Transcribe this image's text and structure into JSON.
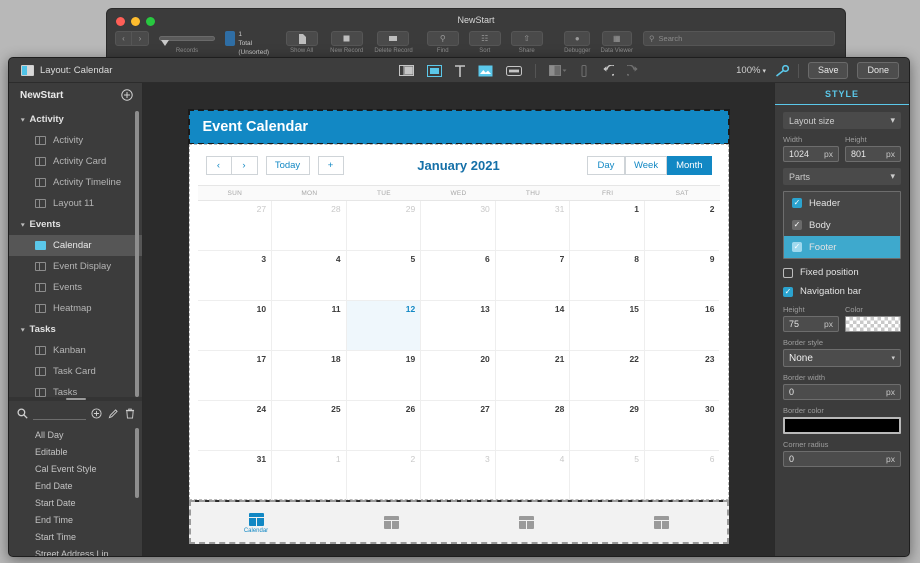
{
  "fm_window": {
    "title": "NewStart",
    "records_label": "Records",
    "record_number": "1",
    "record_total": "Total (Unsorted)",
    "buttons": [
      {
        "label": "Show All",
        "icon": "document-icon"
      },
      {
        "label": "New Record",
        "icon": "new-record-icon"
      },
      {
        "label": "Delete Record",
        "icon": "delete-record-icon"
      },
      {
        "label": "Find",
        "icon": "search-icon"
      },
      {
        "label": "Sort",
        "icon": "sort-icon"
      },
      {
        "label": "Share",
        "icon": "share-icon"
      },
      {
        "label": "Debugger",
        "icon": "debugger-icon"
      },
      {
        "label": "Data Viewer",
        "icon": "data-viewer-icon"
      }
    ],
    "search_placeholder": "Search"
  },
  "topbar": {
    "layout_label": "Layout: Calendar",
    "zoom": "100%",
    "save_label": "Save",
    "done_label": "Done",
    "tools": [
      {
        "name": "layout-parts-icon",
        "active": false
      },
      {
        "name": "insert-field-icon",
        "active": true
      },
      {
        "name": "text-tool-icon",
        "active": false
      },
      {
        "name": "image-tool-icon",
        "active": true
      },
      {
        "name": "button-tool-icon",
        "active": false
      },
      {
        "name": "fill-color-icon",
        "active": false
      },
      {
        "name": "line-weight-icon",
        "active": false
      },
      {
        "name": "undo-icon",
        "active": false
      },
      {
        "name": "redo-icon",
        "active": false
      }
    ],
    "key-icon": "key-icon"
  },
  "sidebar": {
    "title": "NewStart",
    "add_icon": "add-layout-icon",
    "groups": [
      {
        "label": "Activity",
        "items": [
          {
            "label": "Activity",
            "selected": false
          },
          {
            "label": "Activity Card",
            "selected": false
          },
          {
            "label": "Activity Timeline",
            "selected": false
          },
          {
            "label": "Layout 11",
            "selected": false
          }
        ]
      },
      {
        "label": "Events",
        "items": [
          {
            "label": "Calendar",
            "selected": true
          },
          {
            "label": "Event Display",
            "selected": false
          },
          {
            "label": "Events",
            "selected": false
          },
          {
            "label": "Heatmap",
            "selected": false
          }
        ]
      },
      {
        "label": "Tasks",
        "items": [
          {
            "label": "Kanban",
            "selected": false
          },
          {
            "label": "Task Card",
            "selected": false
          },
          {
            "label": "Tasks",
            "selected": false
          }
        ]
      }
    ],
    "fields": {
      "search_value": "",
      "actions": [
        "add-field-icon",
        "edit-field-icon",
        "delete-field-icon"
      ],
      "items": [
        "All Day",
        "Editable",
        "Cal Event Style",
        "End Date",
        "Start Date",
        "End Time",
        "Start Time",
        "Street Address Lin"
      ]
    }
  },
  "calendar": {
    "header_title": "Event Calendar",
    "nav": {
      "prev": "‹",
      "next": "›",
      "today": "Today",
      "add": "+"
    },
    "month_title": "January 2021",
    "views": [
      {
        "label": "Day",
        "active": false
      },
      {
        "label": "Week",
        "active": false
      },
      {
        "label": "Month",
        "active": true
      }
    ],
    "weekdays": [
      "SUN",
      "MON",
      "TUE",
      "WED",
      "THU",
      "FRI",
      "SAT"
    ],
    "weeks": [
      [
        {
          "day": "27",
          "out": true,
          "today": false
        },
        {
          "day": "28",
          "out": true,
          "today": false
        },
        {
          "day": "29",
          "out": true,
          "today": false
        },
        {
          "day": "30",
          "out": true,
          "today": false
        },
        {
          "day": "31",
          "out": true,
          "today": false
        },
        {
          "day": "1",
          "out": false,
          "today": false
        },
        {
          "day": "2",
          "out": false,
          "today": false
        }
      ],
      [
        {
          "day": "3",
          "out": false,
          "today": false
        },
        {
          "day": "4",
          "out": false,
          "today": false
        },
        {
          "day": "5",
          "out": false,
          "today": false
        },
        {
          "day": "6",
          "out": false,
          "today": false
        },
        {
          "day": "7",
          "out": false,
          "today": false
        },
        {
          "day": "8",
          "out": false,
          "today": false
        },
        {
          "day": "9",
          "out": false,
          "today": false
        }
      ],
      [
        {
          "day": "10",
          "out": false,
          "today": false
        },
        {
          "day": "11",
          "out": false,
          "today": false
        },
        {
          "day": "12",
          "out": false,
          "today": true
        },
        {
          "day": "13",
          "out": false,
          "today": false
        },
        {
          "day": "14",
          "out": false,
          "today": false
        },
        {
          "day": "15",
          "out": false,
          "today": false
        },
        {
          "day": "16",
          "out": false,
          "today": false
        }
      ],
      [
        {
          "day": "17",
          "out": false,
          "today": false
        },
        {
          "day": "18",
          "out": false,
          "today": false
        },
        {
          "day": "19",
          "out": false,
          "today": false
        },
        {
          "day": "20",
          "out": false,
          "today": false
        },
        {
          "day": "21",
          "out": false,
          "today": false
        },
        {
          "day": "22",
          "out": false,
          "today": false
        },
        {
          "day": "23",
          "out": false,
          "today": false
        }
      ],
      [
        {
          "day": "24",
          "out": false,
          "today": false
        },
        {
          "day": "25",
          "out": false,
          "today": false
        },
        {
          "day": "26",
          "out": false,
          "today": false
        },
        {
          "day": "27",
          "out": false,
          "today": false
        },
        {
          "day": "28",
          "out": false,
          "today": false
        },
        {
          "day": "29",
          "out": false,
          "today": false
        },
        {
          "day": "30",
          "out": false,
          "today": false
        }
      ],
      [
        {
          "day": "31",
          "out": false,
          "today": false
        },
        {
          "day": "1",
          "out": true,
          "today": false
        },
        {
          "day": "2",
          "out": true,
          "today": false
        },
        {
          "day": "3",
          "out": true,
          "today": false
        },
        {
          "day": "4",
          "out": true,
          "today": false
        },
        {
          "day": "5",
          "out": true,
          "today": false
        },
        {
          "day": "6",
          "out": true,
          "today": false
        }
      ]
    ],
    "tabbar": [
      {
        "label": "Calendar",
        "active": true
      },
      {
        "label": "",
        "active": false
      },
      {
        "label": "",
        "active": false
      },
      {
        "label": "",
        "active": false
      }
    ]
  },
  "inspector": {
    "tab": "STYLE",
    "layout_size": {
      "section": "Layout size",
      "width_label": "Width",
      "width_value": "1024",
      "width_unit": "px",
      "height_label": "Height",
      "height_value": "801",
      "height_unit": "px"
    },
    "parts": {
      "section": "Parts",
      "items": [
        {
          "label": "Header",
          "checked": true,
          "highlight": false
        },
        {
          "label": "Body",
          "checked": true,
          "highlight": false
        },
        {
          "label": "Footer",
          "checked": true,
          "highlight": true
        }
      ],
      "fixed_position": {
        "label": "Fixed position",
        "checked": false
      }
    },
    "navbar": {
      "label": "Navigation bar",
      "checked": true,
      "height_label": "Height",
      "height_value": "75",
      "height_unit": "px",
      "color_label": "Color",
      "color_value": "transparent",
      "border_style_label": "Border style",
      "border_style_value": "None",
      "border_width_label": "Border width",
      "border_width_value": "0",
      "border_width_unit": "px",
      "border_color_label": "Border color",
      "border_color_value": "#000000",
      "corner_radius_label": "Corner radius",
      "corner_radius_value": "0",
      "corner_radius_unit": "px"
    }
  },
  "colors": {
    "accent": "#1288c4",
    "accent_light": "#5bc8ea",
    "chrome": "#3c3c3c"
  }
}
